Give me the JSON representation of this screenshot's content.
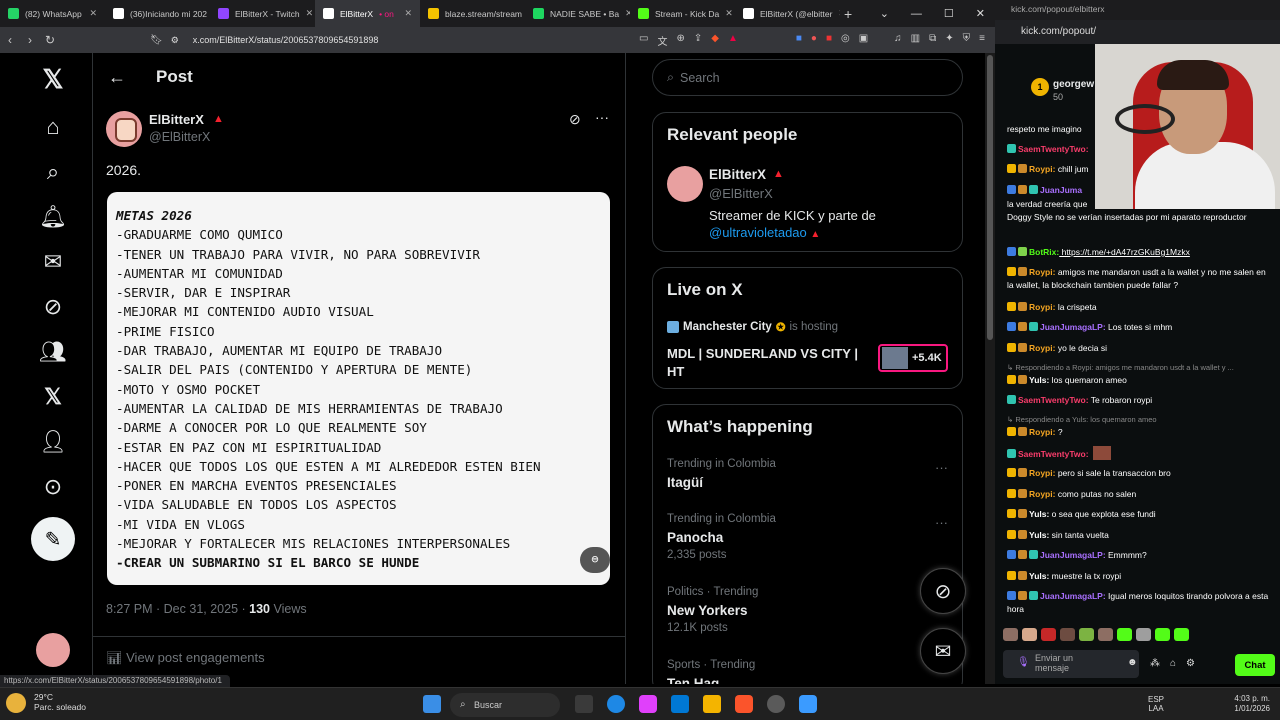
{
  "browser": {
    "tabs": [
      {
        "label": "(82) WhatsApp",
        "color": "#25d366"
      },
      {
        "label": "(36)Iniciando mi 202",
        "color": "#ffffff"
      },
      {
        "label": "ElBitterX - Twitch",
        "color": "#9146ff"
      },
      {
        "label": "ElBitterX",
        "color": "#ffffff",
        "active": true
      },
      {
        "label": "blaze.stream/stream",
        "color": "#f5c400"
      },
      {
        "label": "NADIE SABE • Ba",
        "color": "#1ed760"
      },
      {
        "label": "Stream - Kick Da",
        "color": "#53fc18"
      },
      {
        "label": "ElBitterX (@elbitter",
        "color": "#ffffff"
      }
    ],
    "active_tab_extra": "• on",
    "url": "x.com/ElBitterX/status/2006537809654591898",
    "status_url": "https://x.com/ElBitterX/status/2006537809654591898/photo/1"
  },
  "x": {
    "header_title": "Post",
    "author_name": "ElBitterX",
    "author_handle": "@ElBitterX",
    "post_text": "2026.",
    "image_lines": [
      {
        "text": "METAS 2026",
        "style": "t"
      },
      {
        "text": "-GRADUARME COMO QUMICO",
        "style": ""
      },
      {
        "text": "-TENER UN TRABAJO PARA VIVIR, NO PARA SOBREVIVIR",
        "style": ""
      },
      {
        "text": "-AUMENTAR MI COMUNIDAD",
        "style": ""
      },
      {
        "text": "-SERVIR, DAR E INSPIRAR",
        "style": ""
      },
      {
        "text": "-MEJORAR MI CONTENIDO AUDIO VISUAL",
        "style": ""
      },
      {
        "text": "-PRIME FISICO",
        "style": ""
      },
      {
        "text": "-DAR TRABAJO, AUMENTAR MI EQUIPO DE TRABAJO",
        "style": ""
      },
      {
        "text": "-SALIR DEL PAIS (CONTENIDO Y APERTURA DE MENTE)",
        "style": ""
      },
      {
        "text": "-MOTO Y OSMO POCKET",
        "style": ""
      },
      {
        "text": "-AUMENTAR LA CALIDAD DE MIS HERRAMIENTAS DE TRABAJO",
        "style": ""
      },
      {
        "text": "-DARME A CONOCER POR LO QUE REALMENTE SOY",
        "style": ""
      },
      {
        "text": "-ESTAR EN PAZ CON MI ESPIRITUALIDAD",
        "style": ""
      },
      {
        "text": "-HACER QUE TODOS LOS QUE ESTEN A MI ALREDEDOR ESTEN BIEN",
        "style": ""
      },
      {
        "text": "-PONER EN MARCHA EVENTOS PRESENCIALES",
        "style": ""
      },
      {
        "text": "-VIDA SALUDABLE EN TODOS LOS ASPECTOS",
        "style": ""
      },
      {
        "text": "-MI VIDA EN VLOGS",
        "style": ""
      },
      {
        "text": "-MEJORAR Y FORTALECER MIS RELACIONES INTERPERSONALES",
        "style": ""
      },
      {
        "text": "-CREAR UN SUBMARINO SI EL BARCO SE HUNDE",
        "style": "b"
      }
    ],
    "time": "8:27 PM · Dec 31, 2025 · ",
    "views_count": "130",
    "views_label": " Views",
    "engagements": "View post engagements",
    "search_placeholder": "Search",
    "relevant_title": "Relevant people",
    "rp_name": "ElBitterX",
    "rp_handle": "@ElBitterX",
    "rp_bio": "Streamer de KICK y parte de ",
    "rp_bio_link": "@ultravioletadao",
    "live_title": "Live on X",
    "live_host": "Manchester City",
    "live_hosting": "is hosting",
    "live_event": "MDL | SUNDERLAND VS CITY | HT",
    "live_viewers": "+5.4K",
    "happening_title": "What’s happening",
    "trends": [
      {
        "context": "Trending in Colombia",
        "name": "Itagüí",
        "count": ""
      },
      {
        "context": "Trending in Colombia",
        "name": "Panocha",
        "count": "2,335 posts"
      },
      {
        "context": "Politics · Trending",
        "name": "New Yorkers",
        "count": "12.1K posts"
      },
      {
        "context": "Sports · Trending",
        "name": "Ten Hag",
        "count": ""
      }
    ]
  },
  "kick": {
    "top_url": "kick.com/popout/elbitterx",
    "url2": "kick.com/popout/",
    "top_user": "georgew",
    "top_points": "50",
    "messages": [
      {
        "user": "",
        "text": "respeto me imagino",
        "ucolor": "#ffffff",
        "badges": []
      },
      {
        "user": "SaemTwentyTwo:",
        "text": "",
        "ucolor": "#f93d6b",
        "badges": [
          "bt"
        ]
      },
      {
        "user": "Roypi:",
        "text": " chill jum",
        "ucolor": "#f5a623",
        "badges": [
          "bg",
          "bc"
        ]
      },
      {
        "user": "JuanJuma",
        "text": "",
        "ucolor": "#a970ff",
        "badges": [
          "bb",
          "bc",
          "bt"
        ]
      },
      {
        "user": "",
        "text": "la verdad creería que",
        "ucolor": "#ffffff",
        "badges": []
      },
      {
        "user": "",
        "text": "Doggy Style no se verían insertadas por mi aparato reproductor",
        "ucolor": "#ffffff",
        "badges": []
      },
      {
        "user": "BotRix:",
        "text": " https://t.me/+dA47rzGKuBg1Mzkx",
        "ucolor": "#53fc18",
        "badges": [
          "bb",
          "bgr"
        ]
      },
      {
        "user": "Roypi:",
        "text": " amigos me mandaron usdt a la wallet y no me salen en la wallet, la blockchain tambien puede fallar ?",
        "ucolor": "#f5a623",
        "badges": [
          "bg",
          "bc"
        ]
      },
      {
        "user": "Roypi:",
        "text": " la crispeta",
        "ucolor": "#f5a623",
        "badges": [
          "bg",
          "bc"
        ]
      },
      {
        "user": "JuanJumagaLP:",
        "text": " Los totes si mhm",
        "ucolor": "#a970ff",
        "badges": [
          "bb",
          "bc",
          "bt"
        ]
      },
      {
        "user": "Roypi:",
        "text": " yo le decia si",
        "ucolor": "#f5a623",
        "badges": [
          "bg",
          "bc"
        ]
      },
      {
        "user": "",
        "text": "↳ Respondiendo a Roypi: amigos me mandaron usdt a la wallet y ...",
        "ucolor": "#888888",
        "badges": [],
        "reply": true
      },
      {
        "user": "Yuls:",
        "text": " los quemaron ameo",
        "ucolor": "#ffffff",
        "badges": [
          "bg",
          "bc"
        ]
      },
      {
        "user": "SaemTwentyTwo:",
        "text": " Te robaron roypi",
        "ucolor": "#f93d6b",
        "badges": [
          "bt"
        ]
      },
      {
        "user": "",
        "text": "↳ Respondiendo a Yuls: los quemaron ameo",
        "ucolor": "#888888",
        "badges": [],
        "reply": true
      },
      {
        "user": "Roypi:",
        "text": " ?",
        "ucolor": "#f5a623",
        "badges": [
          "bg",
          "bc"
        ]
      },
      {
        "user": "SaemTwentyTwo:",
        "text": "",
        "ucolor": "#f93d6b",
        "badges": [
          "bt"
        ]
      },
      {
        "user": "Roypi:",
        "text": " pero si sale la transaccion bro",
        "ucolor": "#f5a623",
        "badges": [
          "bg",
          "bc"
        ]
      },
      {
        "user": "Roypi:",
        "text": " como putas no salen",
        "ucolor": "#f5a623",
        "badges": [
          "bg",
          "bc"
        ]
      },
      {
        "user": "Yuls:",
        "text": " o sea que explota ese fundi",
        "ucolor": "#ffffff",
        "badges": [
          "bg",
          "bc"
        ]
      },
      {
        "user": "Yuls:",
        "text": " sin tanta vuelta",
        "ucolor": "#ffffff",
        "badges": [
          "bg",
          "bc"
        ]
      },
      {
        "user": "JuanJumagaLP:",
        "text": " Emmmm?",
        "ucolor": "#a970ff",
        "badges": [
          "bb",
          "bc",
          "bt"
        ]
      },
      {
        "user": "Yuls:",
        "text": " muestre la tx roypi",
        "ucolor": "#ffffff",
        "badges": [
          "bg",
          "bc"
        ]
      },
      {
        "user": "JuanJumagaLP:",
        "text": " Igual meros loquitos tirando polvora a esta hora",
        "ucolor": "#a970ff",
        "badges": [
          "bb",
          "bc",
          "bt"
        ]
      }
    ],
    "input_placeholder": "Enviar un mensaje",
    "chat_button": "Chat"
  },
  "taskbar": {
    "temp": "29°C",
    "weather": "Parc. soleado",
    "search": "Buscar",
    "lang1": "ESP",
    "lang2": "LAA",
    "time": "4:03 p. m.",
    "date": "1/01/2026"
  }
}
